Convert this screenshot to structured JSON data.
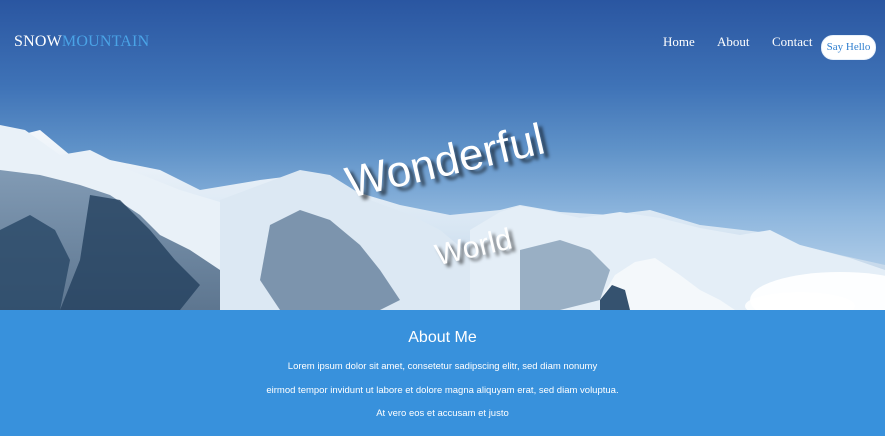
{
  "brand": {
    "part1": "SNOW",
    "part2": "MOUNTAIN"
  },
  "nav": {
    "home": "Home",
    "about": "About",
    "contact": "Contact",
    "cta": "Say Hello"
  },
  "hero": {
    "line1": "Wonderful",
    "line2": "World"
  },
  "about": {
    "title": "About Me",
    "lines": [
      "Lorem ipsum dolor sit amet, consetetur sadipscing elitr, sed diam nonumy",
      "eirmod tempor invidunt ut labore et dolore magna aliquyam erat, sed diam voluptua.",
      "At vero eos et accusam et justo"
    ]
  },
  "colors": {
    "accent": "#3891dc",
    "logo_secondary": "#4aa3e6",
    "sky_top": "#2a56a1"
  }
}
